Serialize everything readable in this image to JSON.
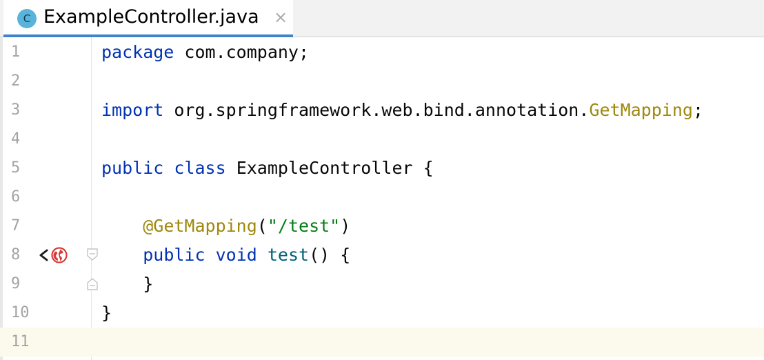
{
  "tab": {
    "icon_letter": "C",
    "title": "ExampleController.java",
    "close": "×"
  },
  "lines": [
    {
      "n": "1",
      "tokens": [
        {
          "t": "package",
          "c": "kw"
        },
        {
          "t": " com.company;",
          "c": ""
        }
      ]
    },
    {
      "n": "2",
      "tokens": []
    },
    {
      "n": "3",
      "tokens": [
        {
          "t": "import",
          "c": "kw"
        },
        {
          "t": " org.springframework.web.bind.annotation.",
          "c": ""
        },
        {
          "t": "GetMapping",
          "c": "ann"
        },
        {
          "t": ";",
          "c": ""
        }
      ]
    },
    {
      "n": "4",
      "tokens": []
    },
    {
      "n": "5",
      "tokens": [
        {
          "t": "public",
          "c": "kw"
        },
        {
          "t": " ",
          "c": ""
        },
        {
          "t": "class",
          "c": "kw"
        },
        {
          "t": " ExampleController {",
          "c": ""
        }
      ]
    },
    {
      "n": "6",
      "tokens": []
    },
    {
      "n": "7",
      "tokens": [
        {
          "t": "    ",
          "c": ""
        },
        {
          "t": "@GetMapping",
          "c": "ann"
        },
        {
          "t": "(",
          "c": ""
        },
        {
          "t": "\"/test\"",
          "c": "str"
        },
        {
          "t": ")",
          "c": ""
        }
      ]
    },
    {
      "n": "8",
      "tokens": [
        {
          "t": "    ",
          "c": ""
        },
        {
          "t": "public",
          "c": "kw"
        },
        {
          "t": " ",
          "c": ""
        },
        {
          "t": "void",
          "c": "kw"
        },
        {
          "t": " ",
          "c": ""
        },
        {
          "t": "test",
          "c": "fn"
        },
        {
          "t": "() {",
          "c": ""
        }
      ]
    },
    {
      "n": "9",
      "tokens": [
        {
          "t": "    }",
          "c": ""
        }
      ]
    },
    {
      "n": "10",
      "tokens": [
        {
          "t": "}",
          "c": ""
        }
      ]
    },
    {
      "n": "11",
      "tokens": []
    }
  ],
  "gutter_icons": {
    "line": "8",
    "icons": [
      "endpoint-navigation-icon",
      "web-globe-icon"
    ]
  },
  "current_line": "11"
}
